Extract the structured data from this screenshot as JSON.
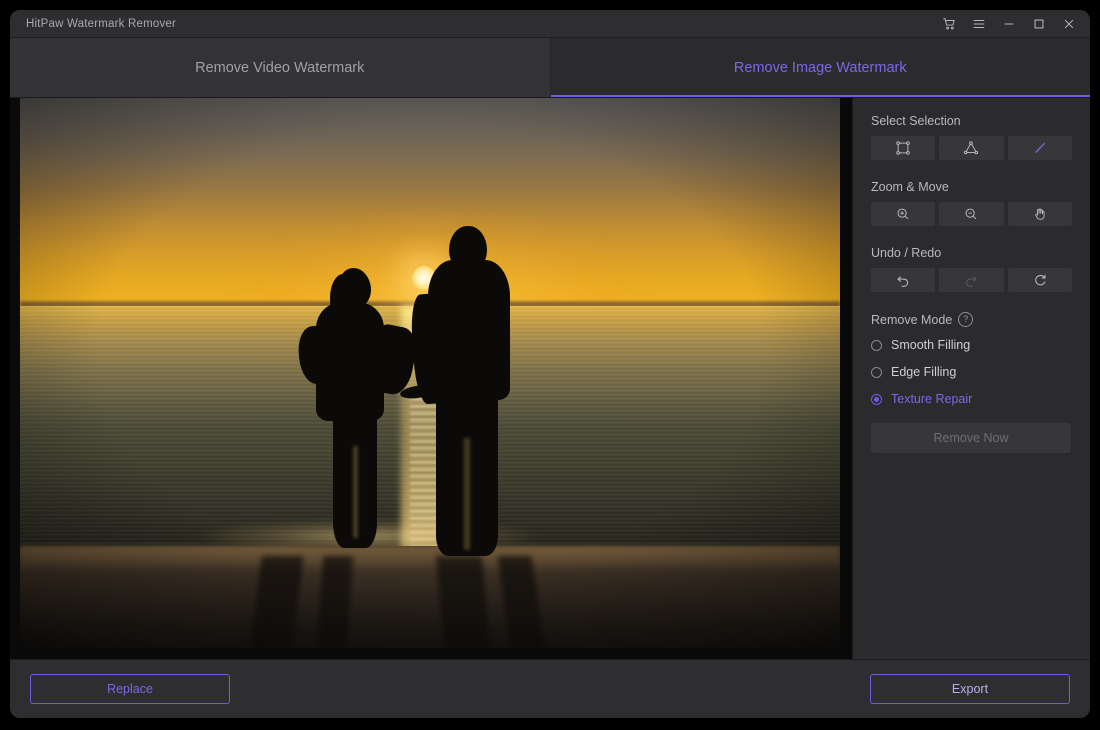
{
  "window": {
    "title": "HitPaw Watermark Remover",
    "controls": [
      {
        "name": "cart-icon",
        "label": "Store"
      },
      {
        "name": "menu-icon",
        "label": "Menu"
      },
      {
        "name": "minimize-icon",
        "label": "Minimize"
      },
      {
        "name": "maximize-icon",
        "label": "Maximize"
      },
      {
        "name": "close-icon",
        "label": "Close"
      }
    ]
  },
  "tabs": [
    {
      "label": "Remove Video Watermark",
      "active": false
    },
    {
      "label": "Remove Image Watermark",
      "active": true
    }
  ],
  "panel": {
    "select_selection": {
      "title": "Select Selection",
      "tools": [
        {
          "name": "rectangle-select-icon",
          "label": "Rectangle Select",
          "state": "normal"
        },
        {
          "name": "polygon-select-icon",
          "label": "Polygon Select",
          "state": "normal"
        },
        {
          "name": "brush-select-icon",
          "label": "Brush Select",
          "state": "active"
        }
      ]
    },
    "zoom_move": {
      "title": "Zoom & Move",
      "tools": [
        {
          "name": "zoom-in-icon",
          "label": "Zoom In",
          "state": "normal"
        },
        {
          "name": "zoom-out-icon",
          "label": "Zoom Out",
          "state": "normal"
        },
        {
          "name": "pan-hand-icon",
          "label": "Move",
          "state": "normal"
        }
      ]
    },
    "undo_redo": {
      "title": "Undo / Redo",
      "tools": [
        {
          "name": "undo-icon",
          "label": "Undo",
          "state": "normal"
        },
        {
          "name": "redo-icon",
          "label": "Redo",
          "state": "disabled"
        },
        {
          "name": "reset-icon",
          "label": "Reset",
          "state": "normal"
        }
      ]
    },
    "remove_mode": {
      "title": "Remove Mode",
      "help_icon": "help-circle-icon",
      "options": [
        {
          "label": "Smooth Filling",
          "selected": false
        },
        {
          "label": "Edge Filling",
          "selected": false
        },
        {
          "label": "Texture Repair",
          "selected": true
        }
      ]
    },
    "remove_now": {
      "label": "Remove Now",
      "enabled": false
    }
  },
  "canvas": {
    "image_description": "Silhouette of a couple holding hands on a beach at sunset over the ocean"
  },
  "footer": {
    "replace_label": "Replace",
    "export_label": "Export"
  },
  "colors": {
    "accent": "#6c5ce7",
    "accent_text": "#7b68e8",
    "panel_bg": "#2b2b2d",
    "titlebar_bg": "#2e2e30",
    "tab_inactive_bg": "#333335",
    "disabled_text": "#6d6d73"
  }
}
